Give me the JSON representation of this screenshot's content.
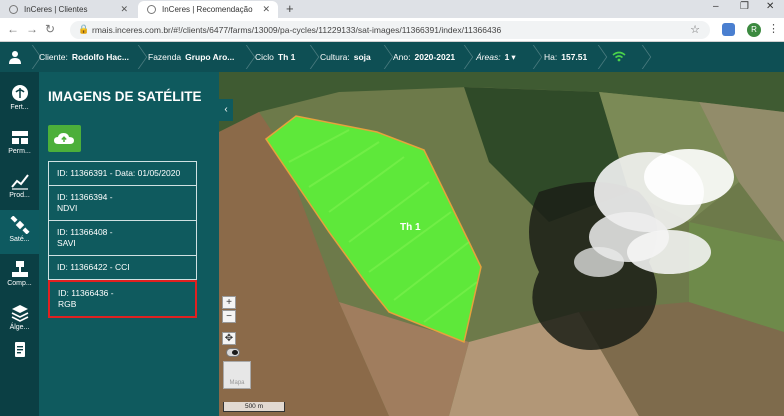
{
  "browser": {
    "tabs": [
      {
        "title": "InCeres | Clientes"
      },
      {
        "title": "InCeres | Recomendação"
      }
    ],
    "new_tab": "+",
    "url": "rmais.inceres.com.br/#!/clients/6477/farms/13009/pa-cycles/11229133/sat-images/11366391/index/11366436",
    "profile_initial": "R",
    "window_controls": {
      "minimize": "–",
      "restore": "❐",
      "close": "✕"
    }
  },
  "header": {
    "client_label": "Cliente:",
    "client_value": "Rodolfo Hac...",
    "farm_label": "Fazenda",
    "farm_value": "Grupo Aro...",
    "cycle_label": "Ciclo",
    "cycle_value": "Th 1",
    "crop_label": "Cultura:",
    "crop_value": "soja",
    "year_label": "Ano:",
    "year_value": "2020-2021",
    "areas_label": "Áreas:",
    "areas_value": "1",
    "ha_label": "Ha:",
    "ha_value": "157.51"
  },
  "nav": [
    {
      "label": "Fert..."
    },
    {
      "label": "Perm..."
    },
    {
      "label": "Prod..."
    },
    {
      "label": "Saté..."
    },
    {
      "label": "Comp..."
    },
    {
      "label": "Álge..."
    },
    {
      "label": ""
    }
  ],
  "panel": {
    "title": "IMAGENS DE SATÉLITE",
    "images": [
      {
        "line1": "ID: 11366391 - Data: 01/05/2020",
        "line2": ""
      },
      {
        "line1": "ID: 11366394 -",
        "line2": "NDVI"
      },
      {
        "line1": "ID: 11366408 -",
        "line2": "SAVI"
      },
      {
        "line1": "ID: 11366422 - CCI",
        "line2": ""
      },
      {
        "line1": "ID: 11366436 -",
        "line2": "RGB"
      }
    ]
  },
  "map": {
    "field_label": "Th 1",
    "zoom_in": "+",
    "zoom_out": "−",
    "scale_label": "500 m",
    "minimap_label": "Mapa"
  },
  "colors": {
    "header": "#0e4f54",
    "panel": "#0f5a5e",
    "upload": "#4caf3a",
    "field": "#5ee83a",
    "selected_border": "#e02020"
  }
}
